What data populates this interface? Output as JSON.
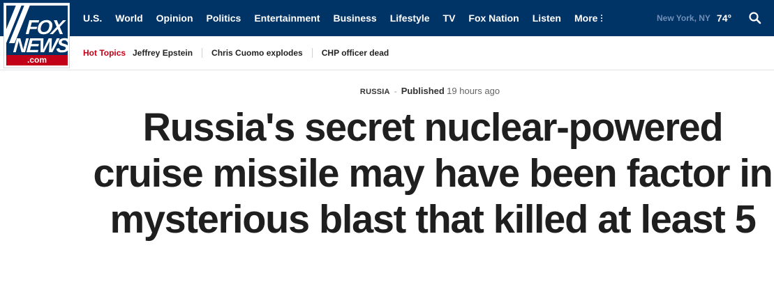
{
  "brand": {
    "logo_line1": "FOX",
    "logo_line2": "NEWS",
    "logo_domain": ".com",
    "colors": {
      "navy": "#003366",
      "red": "#c20017"
    }
  },
  "nav": {
    "items": [
      "U.S.",
      "World",
      "Opinion",
      "Politics",
      "Entertainment",
      "Business",
      "Lifestyle",
      "TV",
      "Fox Nation",
      "Listen"
    ],
    "more_label": "More"
  },
  "weather": {
    "city": "New York, NY",
    "temp": "74°"
  },
  "search": {
    "icon": "search-icon"
  },
  "hot_topics": {
    "label": "Hot Topics",
    "links": [
      "Jeffrey Epstein",
      "Chris Cuomo explodes",
      "CHP officer dead"
    ]
  },
  "article": {
    "category": "RUSSIA",
    "published_label": "Published",
    "published_time": "19 hours ago",
    "headline": "Russia's secret nuclear-powered cruise missile may have been factor in mysterious blast that killed at least 5"
  }
}
